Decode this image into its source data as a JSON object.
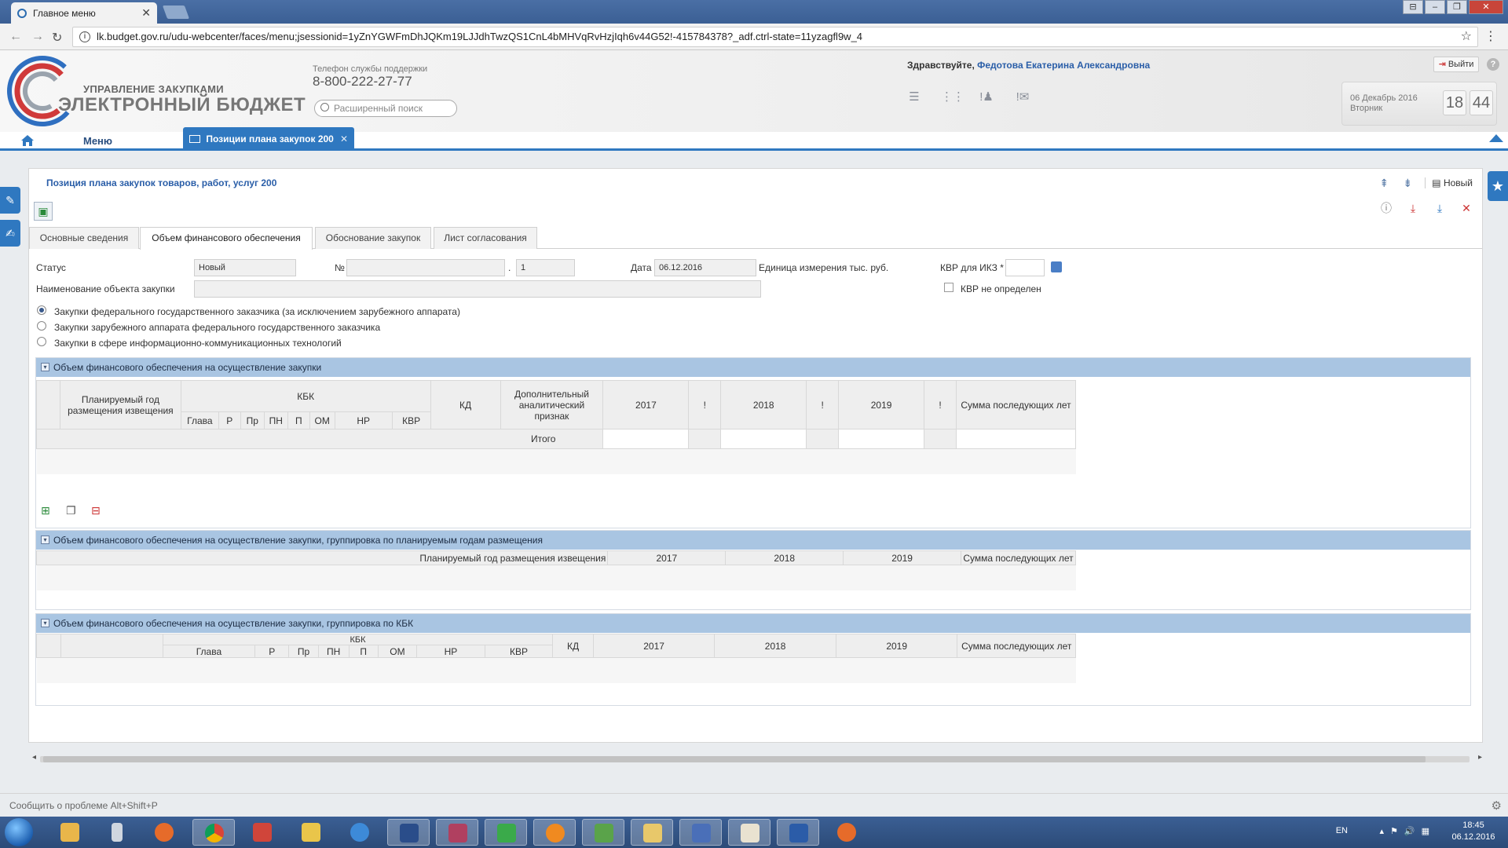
{
  "browser": {
    "tab_title": "Главное меню",
    "url": "lk.budget.gov.ru/udu-webcenter/faces/menu;jsessionid=1yZnYGWFmDhJQKm19LJJdhTwzQS1CnL4bMHVqRvHzjIqh6v44G52!-415784378?_adf.ctrl-state=11yzagfl9w_4"
  },
  "header": {
    "logo_sub": "УПРАВЛЕНИЕ ЗАКУПКАМИ",
    "logo_main": "ЭЛЕКТРОННЫЙ БЮДЖЕТ",
    "support_label": "Телефон службы поддержки",
    "support_phone": "8-800-222-27-77",
    "search_placeholder": "Расширенный поиск",
    "greeting": "Здравствуйте,",
    "user_name": "Федотова Екатерина Александровна",
    "logout_label": "Выйти",
    "date_text": "06 Декабрь 2016",
    "weekday": "Вторник",
    "hours": "18",
    "minutes": "44"
  },
  "menubar": {
    "menu_label": "Меню",
    "active_tab": "Позиции плана закупок 200"
  },
  "form": {
    "title": "Позиция плана закупок товаров, работ, услуг 200",
    "new_label": "Новый",
    "tabs": [
      "Основные сведения",
      "Объем финансового обеспечения",
      "Обоснование закупок",
      "Лист согласования"
    ],
    "status_label": "Статус",
    "status_value": "Новый",
    "number_label": "№",
    "number_value": "",
    "number_suffix_sep": ".",
    "number_suffix": "1",
    "date_label": "Дата",
    "date_value": "06.12.2016",
    "unit_label": "Единица измерения тыс. руб.",
    "kvr_label": "КВР для ИКЗ *",
    "kvr_value": "",
    "kvr_undefined_label": "КВР не определен",
    "object_label": "Наименование объекта закупки",
    "object_value": "",
    "radios": [
      "Закупки федерального государственного заказчика (за исключением зарубежного аппарата)",
      "Закупки зарубежного аппарата федерального государственного заказчика",
      "Закупки в сфере информационно-коммуникационных технологий"
    ]
  },
  "panel1": {
    "title": "Объем финансового обеспечения на осуществление закупки",
    "h_year": "Планируемый год размещения извещения",
    "h_kbk": "КБК",
    "kbk_cols": [
      "Глава",
      "Р",
      "Пр",
      "ПН",
      "П",
      "ОМ",
      "НР",
      "КВР"
    ],
    "h_kd": "КД",
    "h_extra": "Дополнительный аналитический признак",
    "years": [
      "2017",
      "2018",
      "2019"
    ],
    "h_excl": "!",
    "h_later": "Сумма последующих лет",
    "total_label": "Итого"
  },
  "panel2": {
    "title": "Объем финансового обеспечения на осуществление закупки, группировка по планируемым годам размещения",
    "h_year": "Планируемый год размещения извещения",
    "years": [
      "2017",
      "2018",
      "2019"
    ],
    "h_later": "Сумма последующих лет"
  },
  "panel3": {
    "title": "Объем финансового обеспечения на осуществление закупки, группировка по КБК",
    "h_kbk": "КБК",
    "kbk_cols": [
      "Глава",
      "Р",
      "Пр",
      "ПН",
      "П",
      "ОМ",
      "НР",
      "КВР"
    ],
    "h_kd": "КД",
    "years": [
      "2017",
      "2018",
      "2019"
    ],
    "h_later": "Сумма последующих лет"
  },
  "status_text": "Сообщить о проблеме Alt+Shift+P",
  "taskbar": {
    "lang": "EN",
    "time": "18:45",
    "date": "06.12.2016"
  }
}
